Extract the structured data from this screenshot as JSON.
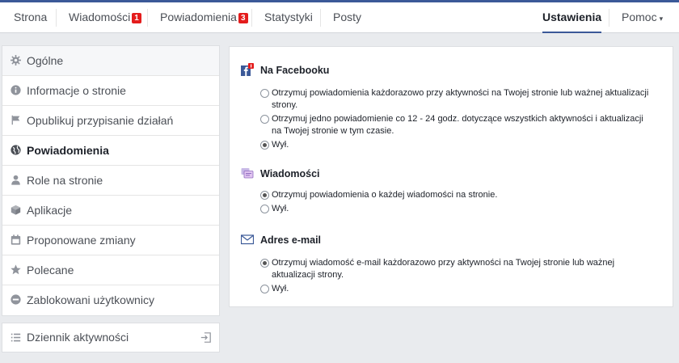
{
  "topnav": {
    "tabs": [
      {
        "label": "Strona"
      },
      {
        "label": "Wiadomości",
        "badge": "1"
      },
      {
        "label": "Powiadomienia",
        "badge": "3"
      },
      {
        "label": "Statystyki"
      },
      {
        "label": "Posty"
      }
    ],
    "settings_label": "Ustawienia",
    "help_label": "Pomoc",
    "help_caret": "▾"
  },
  "sidebar": {
    "items": [
      {
        "label": "Ogólne",
        "icon": "gear-icon"
      },
      {
        "label": "Informacje o stronie",
        "icon": "info-icon"
      },
      {
        "label": "Opublikuj przypisanie działań",
        "icon": "flag-icon"
      },
      {
        "label": "Powiadomienia",
        "icon": "globe-icon"
      },
      {
        "label": "Role na stronie",
        "icon": "person-icon"
      },
      {
        "label": "Aplikacje",
        "icon": "cube-icon"
      },
      {
        "label": "Proponowane zmiany",
        "icon": "calendar-icon"
      },
      {
        "label": "Polecane",
        "icon": "star-icon"
      },
      {
        "label": "Zablokowani użytkownicy",
        "icon": "blocked-icon"
      }
    ],
    "activity_label": "Dziennik aktywności"
  },
  "sections": {
    "facebook": {
      "title": "Na Facebooku",
      "options": [
        {
          "label": "Otrzymuj powiadomienia każdorazowo przy aktywności na Twojej stronie lub ważnej aktualizacji strony.",
          "selected": false
        },
        {
          "label": "Otrzymuj jedno powiadomienie co 12 - 24 godz. dotyczące wszystkich aktywności i aktualizacji na Twojej stronie w tym czasie.",
          "selected": false
        },
        {
          "label": "Wył.",
          "selected": true
        }
      ]
    },
    "messages": {
      "title": "Wiadomości",
      "options": [
        {
          "label": "Otrzymuj powiadomienia o każdej wiadomości na stronie.",
          "selected": true
        },
        {
          "label": "Wył.",
          "selected": false
        }
      ]
    },
    "email": {
      "title": "Adres e-mail",
      "options": [
        {
          "label": "Otrzymuj wiadomość e-mail każdorazowo przy aktywności na Twojej stronie lub ważnej aktualizacji strony.",
          "selected": true
        },
        {
          "label": "Wył.",
          "selected": false
        }
      ]
    }
  },
  "colors": {
    "accent": "#3b5998",
    "badge": "#e41c1c",
    "background": "#e9ebee"
  }
}
